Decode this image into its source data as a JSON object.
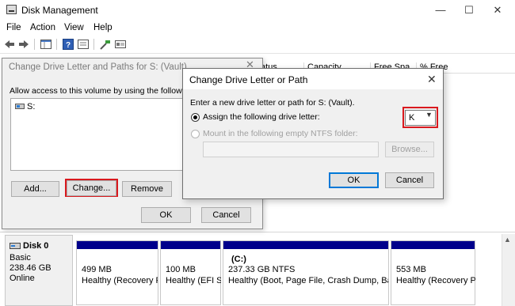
{
  "app": {
    "title": "Disk Management"
  },
  "window_controls": {
    "minimize": "—",
    "maximize": "☐",
    "close": "✕"
  },
  "menu": {
    "items": [
      "File",
      "Action",
      "View",
      "Help"
    ]
  },
  "volume_columns": [
    "tatus",
    "Capacity",
    "Free Spa",
    "% Free"
  ],
  "disk": {
    "name": "Disk 0",
    "type": "Basic",
    "size": "238.46 GB",
    "status": "Online"
  },
  "partitions": [
    {
      "name": "",
      "size": "499 MB",
      "status": "Healthy (Recovery P"
    },
    {
      "name": "",
      "size": "100 MB",
      "status": "Healthy (EFI Sy"
    },
    {
      "name": "(C:)",
      "size": "237.33 GB NTFS",
      "status": "Healthy (Boot, Page File, Crash Dump, Basic"
    },
    {
      "name": "",
      "size": "553 MB",
      "status": "Healthy (Recovery Pa"
    }
  ],
  "dialog_paths": {
    "title": "Change Drive Letter and Paths for S: (Vault)",
    "close": "✕",
    "description": "Allow access to this volume by using the following driv",
    "list_items": [
      "S:"
    ],
    "add_label": "Add...",
    "change_label": "Change...",
    "remove_label": "Remove",
    "ok_label": "OK",
    "cancel_label": "Cancel"
  },
  "dialog_letter": {
    "title": "Change Drive Letter or Path",
    "close": "✕",
    "description": "Enter a new drive letter or path for S: (Vault).",
    "option_assign": "Assign the following drive letter:",
    "option_mount": "Mount in the following empty NTFS folder:",
    "selected_letter": "K",
    "folder_value": "",
    "browse_label": "Browse...",
    "ok_label": "OK",
    "cancel_label": "Cancel"
  },
  "colors": {
    "partition_bar": "#00008b",
    "highlight": "#d9191e",
    "focus": "#0078d7"
  }
}
